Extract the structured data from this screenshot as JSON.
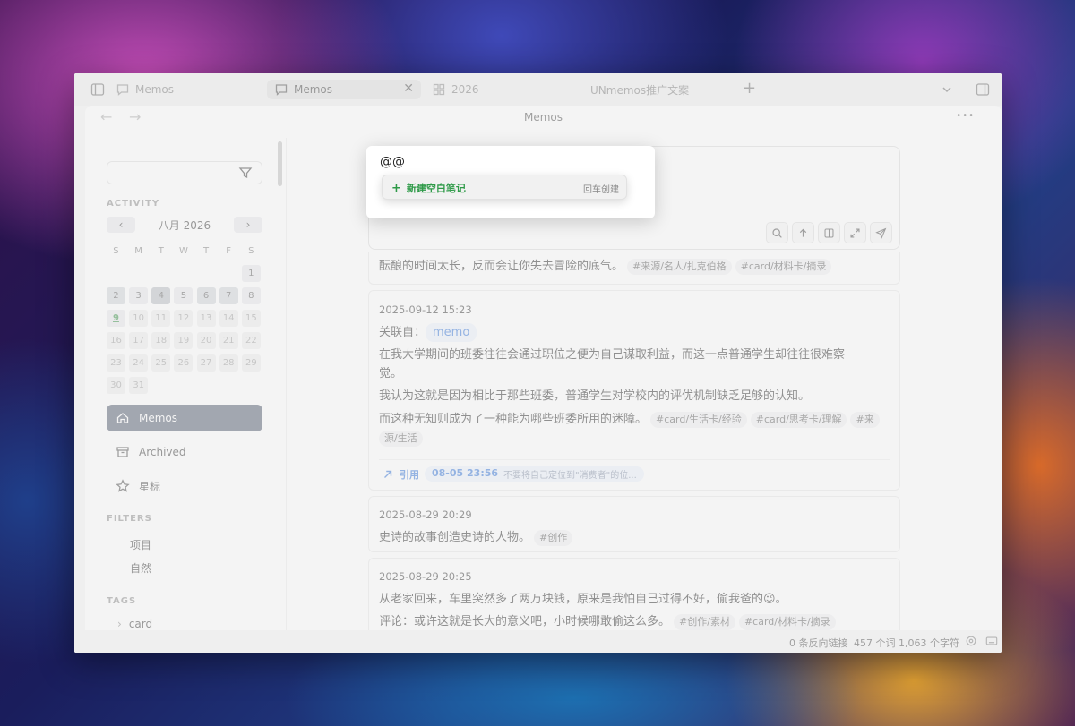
{
  "tabbar": {
    "left_label": "Memos",
    "active_tab": "Memos",
    "tab_2026": "2026",
    "tab_doc": "UNmemos推广文案",
    "new_tab": "+",
    "close": "✕"
  },
  "nav": {
    "title": "Memos",
    "back": "←",
    "forward": "→",
    "more": "•••"
  },
  "sidebar": {
    "activity_label": "ACTIVITY",
    "calendar": {
      "month": "八月 2026",
      "prev": "‹",
      "next": "›",
      "weekdays": [
        "S",
        "M",
        "T",
        "W",
        "T",
        "F",
        "S"
      ],
      "rows": [
        [
          "",
          "",
          "",
          "",
          "",
          "",
          "1"
        ],
        [
          "2",
          "3",
          "4",
          "5",
          "6",
          "7",
          "8"
        ],
        [
          "9",
          "10",
          "11",
          "12",
          "13",
          "14",
          "15"
        ],
        [
          "16",
          "17",
          "18",
          "19",
          "20",
          "21",
          "22"
        ],
        [
          "23",
          "24",
          "25",
          "26",
          "27",
          "28",
          "29"
        ],
        [
          "30",
          "31",
          "",
          "",
          "",
          "",
          ""
        ]
      ]
    },
    "nav_memos": "Memos",
    "nav_archived": "Archived",
    "nav_starred": "星标",
    "filters_label": "FILTERS",
    "filter_items": [
      "项目",
      "自然"
    ],
    "tags_label": "TAGS",
    "tag_card": "card",
    "tag_chevron": "›"
  },
  "editor": {
    "text": "@@",
    "suggestion_plus": "+",
    "suggestion_label": "新建空白笔记",
    "suggestion_hint": "回车创建"
  },
  "memos": [
    {
      "text": "酝酿的时间太长，反而会让你失去冒险的底气。",
      "tags": [
        "#来源/名人/扎克伯格",
        "#card/材料卡/摘录"
      ]
    },
    {
      "timestamp": "2025-09-12 15:23",
      "related_prefix": "关联自：",
      "related_link": "memo",
      "line1": "在我大学期间的班委往往会通过职位之便为自己谋取利益，而这一点普通学生却往往很难察",
      "line1b": "觉。",
      "line2": "我认为这就是因为相比于那些班委，普通学生对学校内的评优机制缺乏足够的认知。",
      "line3": "而这种无知则成为了一种能为哪些班委所用的迷障。",
      "tags": [
        "#card/生活卡/经验",
        "#card/思考卡/理解",
        "#来"
      ],
      "tag_wrap": "源/生活",
      "ref_label": "引用",
      "ref_time": "08-05 23:56",
      "ref_text": "不要将自己定位到\"消费者\"的位..."
    },
    {
      "timestamp": "2025-08-29 20:29",
      "text": "史诗的故事创造史诗的人物。",
      "tags": [
        "#创作"
      ]
    },
    {
      "timestamp": "2025-08-29 20:25",
      "line1": "从老家回来，车里突然多了两万块钱，原来是我怕自己过得不好，偷我爸的😉。",
      "line2": "评论：或许这就是长大的意义吧，小时候哪敢偷这么多。",
      "tags": [
        "#创作/素材",
        "#card/材料卡/摘录"
      ]
    }
  ],
  "status": {
    "backlinks": "0 条反向链接",
    "words": "457 个词",
    "chars": "1,063 个字符"
  }
}
